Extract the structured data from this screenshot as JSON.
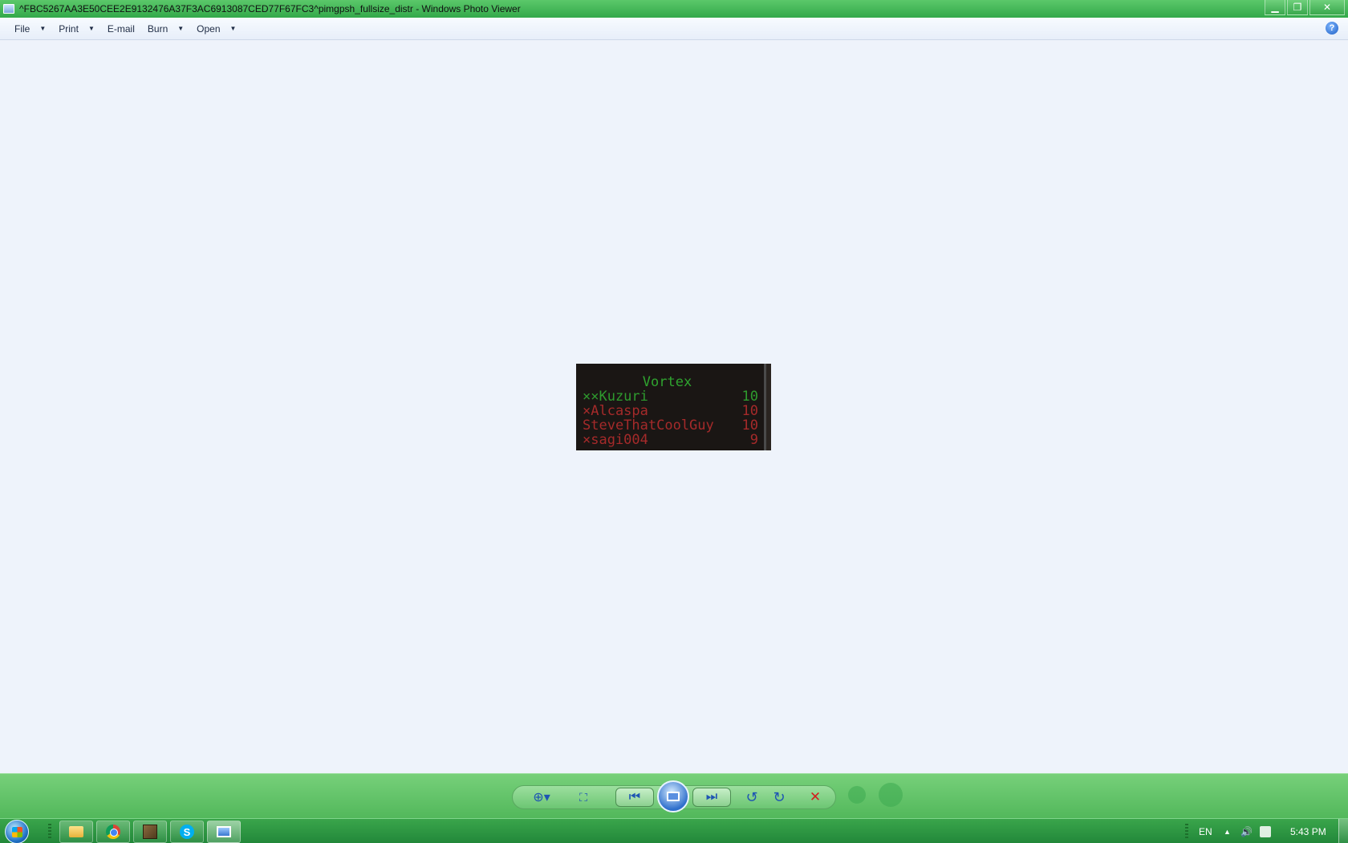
{
  "window": {
    "title": "^FBC5267AA3E50CEE2E9132476A37F3AC6913087CED77F67FC3^pimgpsh_fullsize_distr - Windows Photo Viewer",
    "minimize": "▁",
    "maximize": "❐",
    "close": "✕"
  },
  "menu": {
    "items": [
      {
        "label": "File",
        "arrow": "▼"
      },
      {
        "label": "Print",
        "arrow": "▼"
      },
      {
        "label": "E-mail",
        "arrow": ""
      },
      {
        "label": "Burn",
        "arrow": "▼"
      },
      {
        "label": "Open",
        "arrow": "▼"
      }
    ],
    "help": "?"
  },
  "photo": {
    "scoreboard_title": "Vortex",
    "rows": [
      {
        "name": "××Kuzuri",
        "score": "10",
        "color": "green"
      },
      {
        "name": "×Alcaspa",
        "score": "10",
        "color": "red"
      },
      {
        "name": "SteveThatCoolGuy",
        "score": "10",
        "color": "red"
      },
      {
        "name": "×sagi004",
        "score": "9",
        "color": "red"
      }
    ]
  },
  "controls": {
    "zoom": "⊕▾",
    "fit": "⛶",
    "previous": "⏮",
    "next": "⏭",
    "rotate_ccw": "↺",
    "rotate_cw": "↻",
    "delete": "✕"
  },
  "taskbar": {
    "apps": [
      "folder-icon",
      "chrome-icon",
      "minecraft-icon",
      "skype-icon",
      "photo-viewer-icon"
    ],
    "skype_letter": "S",
    "language": "EN",
    "tray_arrow": "▲",
    "volume": "🔊",
    "time": "5:43 PM"
  }
}
